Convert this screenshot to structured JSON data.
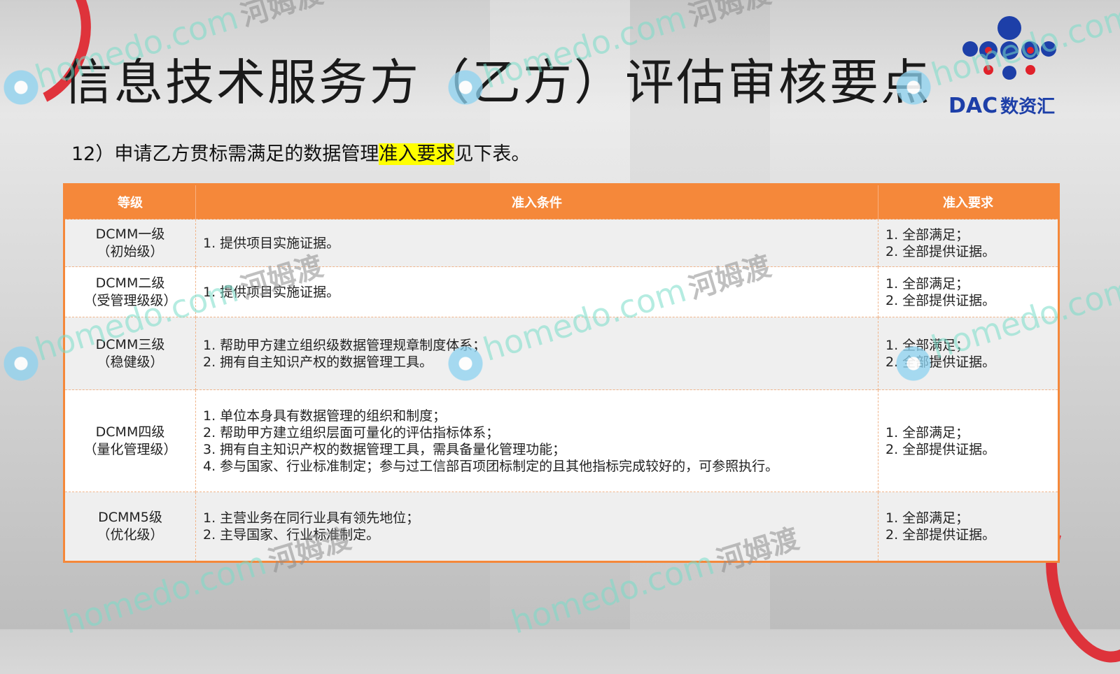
{
  "title": "信息技术服务方（乙方）评估审核要点",
  "subtitle": {
    "before": "12）申请乙方贯标需满足的数据管理",
    "highlight": "准入要求",
    "after": "见下表。"
  },
  "logo": {
    "brand": "DAC",
    "cn": "数资汇"
  },
  "colors": {
    "header": "#f5883a",
    "highlight": "#ffff00",
    "logo": "#1d3fa8",
    "logo_dots": "#e0222b"
  },
  "table": {
    "headers": [
      "等级",
      "准入条件",
      "准入要求"
    ],
    "rows": [
      {
        "level_line1": "DCMM一级",
        "level_line2": "（初始级）",
        "conditions": [
          "1.  提供项目实施证据。"
        ],
        "requirements": [
          "1.  全部满足；",
          "2.  全部提供证据。"
        ]
      },
      {
        "level_line1": "DCMM二级",
        "level_line2": "（受管理级级）",
        "conditions": [
          "1.  提供项目实施证据。"
        ],
        "requirements": [
          "1.  全部满足；",
          "2.  全部提供证据。"
        ]
      },
      {
        "level_line1": "DCMM三级",
        "level_line2": "（稳健级）",
        "conditions": [
          "1.  帮助甲方建立组织级数据管理规章制度体系；",
          "2.  拥有自主知识产权的数据管理工具。"
        ],
        "requirements": [
          "1.  全部满足；",
          "2.  全部提供证据。"
        ]
      },
      {
        "level_line1": "DCMM四级",
        "level_line2": "（量化管理级）",
        "conditions": [
          "1.  单位本身具有数据管理的组织和制度；",
          "2.  帮助甲方建立组织层面可量化的评估指标体系；",
          "3.  拥有自主知识产权的数据管理工具，需具备量化管理功能；",
          "4.  参与国家、行业标准制定；参与过工信部百项团标制定的且其他指标完成较好的，可参照执行。"
        ],
        "requirements": [
          "1.  全部满足；",
          "2.  全部提供证据。"
        ]
      },
      {
        "level_line1": "DCMM5级",
        "level_line2": "（优化级）",
        "conditions": [
          "1.  主营业务在同行业具有领先地位；",
          "2.  主导国家、行业标准制定。"
        ],
        "requirements": [
          "1.  全部满足；",
          "2.  全部提供证据。"
        ]
      }
    ]
  },
  "watermark": {
    "en": "homedo.com",
    "cn": "河姆渡"
  }
}
